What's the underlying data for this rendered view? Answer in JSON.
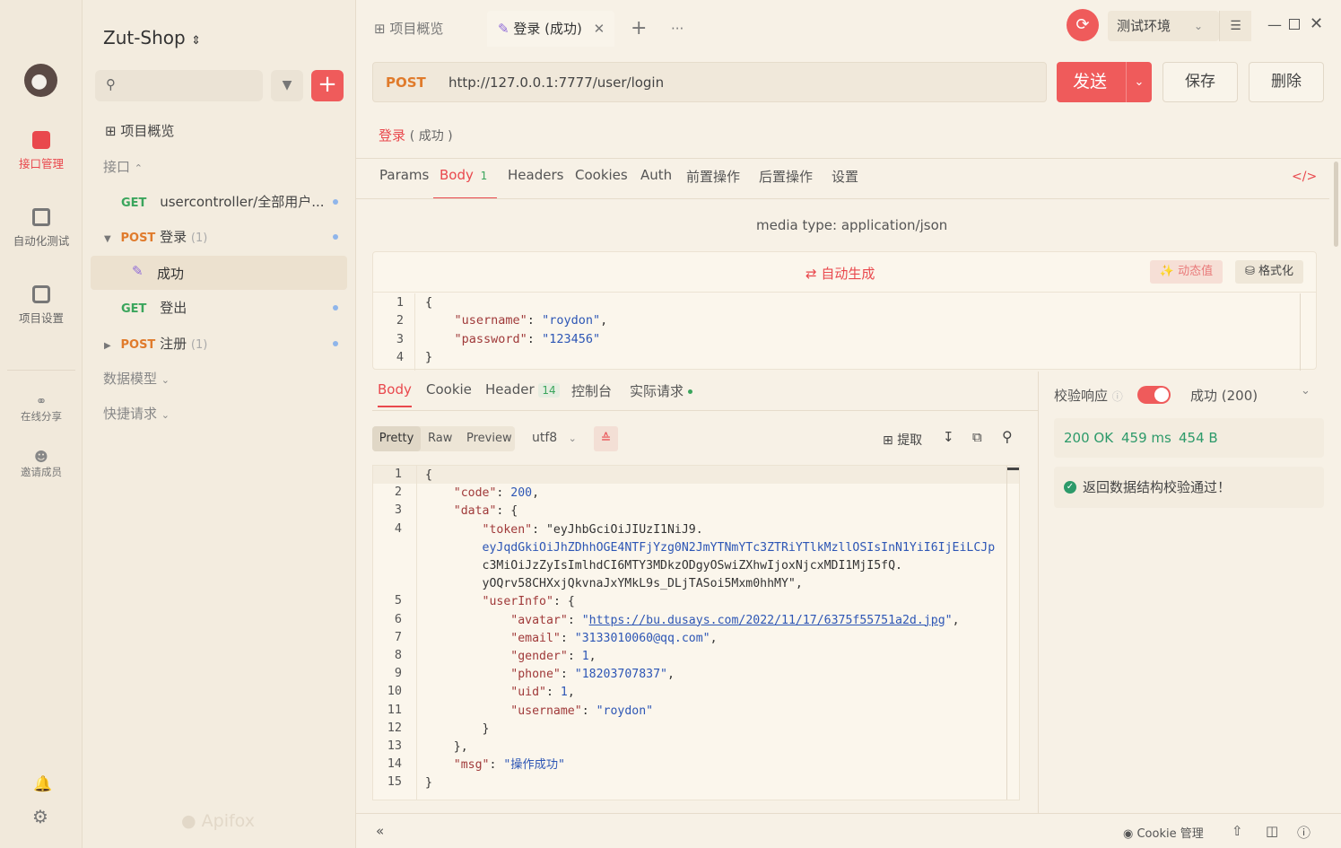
{
  "rail": {
    "items": [
      {
        "label": "接口管理",
        "icon": "api-icon"
      },
      {
        "label": "自动化测试",
        "icon": "automation-icon"
      },
      {
        "label": "项目设置",
        "icon": "settings-icon"
      }
    ],
    "share": "在线分享",
    "invite": "邀请成员"
  },
  "sidebar": {
    "project": "Zut-Shop",
    "overview": "项目概览",
    "api_group": "接口",
    "apis": [
      {
        "method": "GET",
        "name": "usercontroller/全部用户..."
      },
      {
        "method": "POST",
        "name": "登录",
        "count": "(1)"
      },
      {
        "case": "成功"
      },
      {
        "method": "GET",
        "name": "登出"
      },
      {
        "method": "POST",
        "name": "注册",
        "count": "(1)"
      }
    ],
    "data_model": "数据模型",
    "quick_request": "快捷请求",
    "brand": "Apifox"
  },
  "tabs": {
    "overview": "项目概览",
    "active": "登录 (成功)",
    "env": "测试环境"
  },
  "request": {
    "method": "POST",
    "url": "http://127.0.0.1:7777/user/login",
    "send": "发送",
    "save": "保存",
    "delete": "删除",
    "name": "登录",
    "case": "( 成功 )",
    "subtabs": [
      "Params",
      "Body",
      "Headers",
      "Cookies",
      "Auth",
      "前置操作",
      "后置操作",
      "设置"
    ],
    "body_count": "1",
    "media_type": "media type: application/json",
    "auto_gen": "自动生成",
    "dynamic": "动态值",
    "format": "格式化"
  },
  "request_body": [
    "{",
    "    \"username\": \"roydon\",",
    "    \"password\": \"123456\"",
    "}"
  ],
  "response": {
    "tabs": [
      "Body",
      "Cookie",
      "Header",
      "控制台",
      "实际请求"
    ],
    "header_count": "14",
    "modes": [
      "Pretty",
      "Raw",
      "Preview"
    ],
    "encoding": "utf8",
    "extract": "提取",
    "lines": [
      {
        "n": "1",
        "t": "{"
      },
      {
        "n": "2",
        "t": "    \"code\": 200,"
      },
      {
        "n": "3",
        "t": "    \"data\": {"
      },
      {
        "n": "4",
        "t": "        \"token\": \"eyJhbGciOiJIUzI1NiJ9."
      },
      {
        "n": "",
        "t": "        eyJqdGkiOiJhZDhhOGE4NTFjYzg0N2JmYTNmYTc3ZTRiYTlkMzllOSIsInN1YiI6IjEiLCJp"
      },
      {
        "n": "",
        "t": "        c3MiOiJzZyIsImlhdCI6MTY3MDkzODgyOSwiZXhwIjoxNjcxMDI1MjI5fQ."
      },
      {
        "n": "",
        "t": "        yOQrv58CHXxjQkvnaJxYMkL9s_DLjTASoi5Mxm0hhMY\","
      },
      {
        "n": "5",
        "t": "        \"userInfo\": {"
      },
      {
        "n": "6",
        "t": "            \"avatar\": \"https://bu.dusays.com/2022/11/17/6375f55751a2d.jpg\","
      },
      {
        "n": "7",
        "t": "            \"email\": \"3133010060@qq.com\","
      },
      {
        "n": "8",
        "t": "            \"gender\": 1,"
      },
      {
        "n": "9",
        "t": "            \"phone\": \"18203707837\","
      },
      {
        "n": "10",
        "t": "            \"uid\": 1,"
      },
      {
        "n": "11",
        "t": "            \"username\": \"roydon\""
      },
      {
        "n": "12",
        "t": "        }"
      },
      {
        "n": "13",
        "t": "    },"
      },
      {
        "n": "14",
        "t": "    \"msg\": \"操作成功\""
      },
      {
        "n": "15",
        "t": "}"
      }
    ]
  },
  "validation": {
    "label": "校验响应",
    "result": "成功 (200)",
    "status": "200 OK",
    "time": "459 ms",
    "size": "454 B",
    "message": "返回数据结构校验通过！"
  },
  "statusbar": {
    "cookie": "Cookie 管理"
  },
  "colors": {
    "accent": "#ef5b5b",
    "get": "#3aa55c",
    "post": "#e07b2c",
    "ok": "#2d9a6a"
  }
}
